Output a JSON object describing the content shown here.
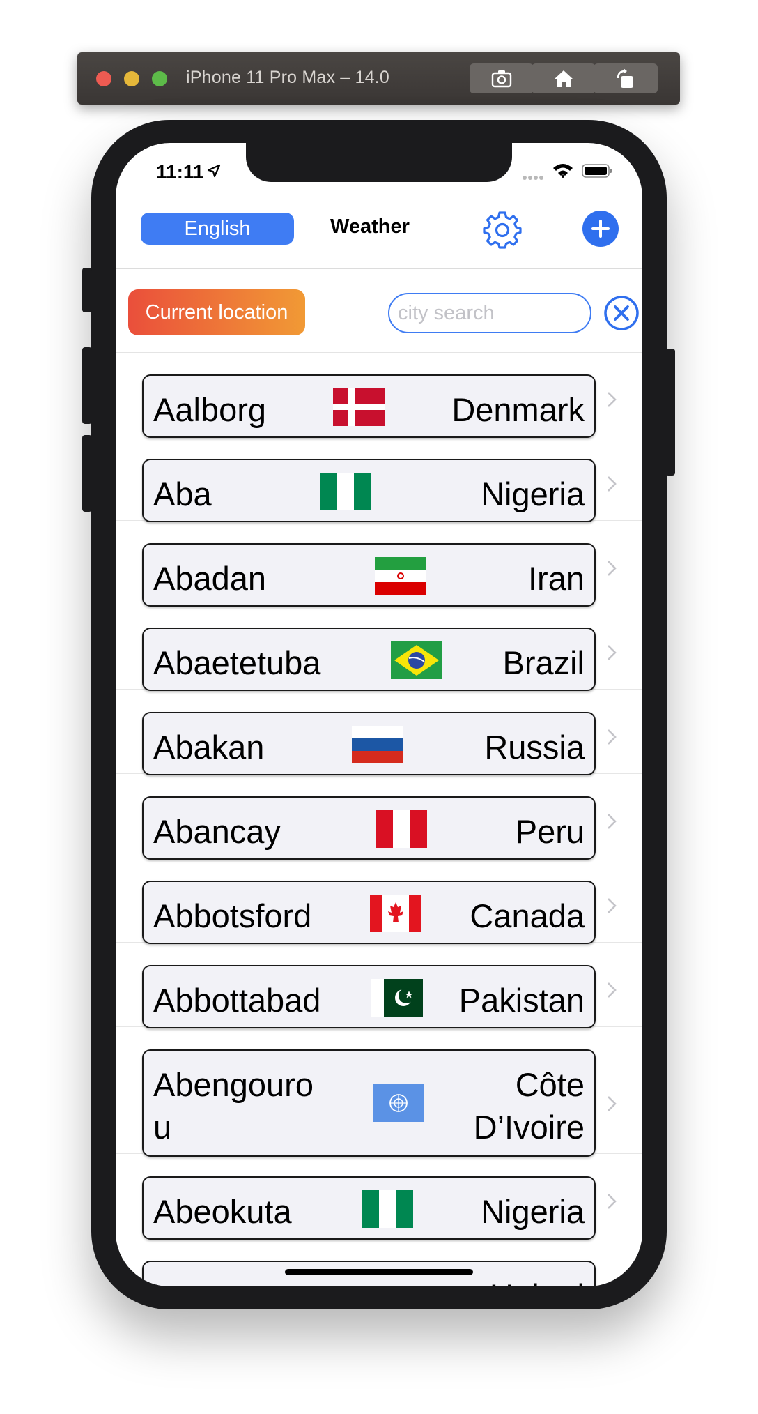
{
  "simulator": {
    "title": "iPhone 11 Pro Max – 14.0",
    "buttons": [
      "screenshot-icon",
      "home-icon",
      "rotate-icon"
    ]
  },
  "status_bar": {
    "time": "11:11"
  },
  "nav": {
    "language_button": "English",
    "title": "Weather",
    "settings_icon": "gear-icon",
    "add_icon": "plus-icon"
  },
  "search": {
    "current_location_button": "Current location",
    "placeholder": "city search",
    "clear_icon": "close-circle-icon"
  },
  "cities": [
    {
      "city": "Aalborg",
      "country": "Denmark",
      "flag": "denmark-flag-icon"
    },
    {
      "city": "Aba",
      "country": "Nigeria",
      "flag": "nigeria-flag-icon"
    },
    {
      "city": "Abadan",
      "country": "Iran",
      "flag": "iran-flag-icon"
    },
    {
      "city": "Abaetetuba",
      "country": "Brazil",
      "flag": "brazil-flag-icon"
    },
    {
      "city": "Abakan",
      "country": "Russia",
      "flag": "russia-flag-icon"
    },
    {
      "city": "Abancay",
      "country": "Peru",
      "flag": "peru-flag-icon"
    },
    {
      "city": "Abbotsford",
      "country": "Canada",
      "flag": "canada-flag-icon"
    },
    {
      "city": "Abbottabad",
      "country": "Pakistan",
      "flag": "pakistan-flag-icon"
    },
    {
      "city": "Abengourou",
      "country": "Côte D’Ivoire",
      "flag": "un-flag-icon"
    },
    {
      "city": "Abeokuta",
      "country": "Nigeria",
      "flag": "nigeria-flag-icon"
    },
    {
      "city": "",
      "country": "United",
      "flag": ""
    }
  ],
  "colors": {
    "accent": "#3f7cf3",
    "current_location_gradient": [
      "#ea4f3b",
      "#f19a35"
    ]
  }
}
